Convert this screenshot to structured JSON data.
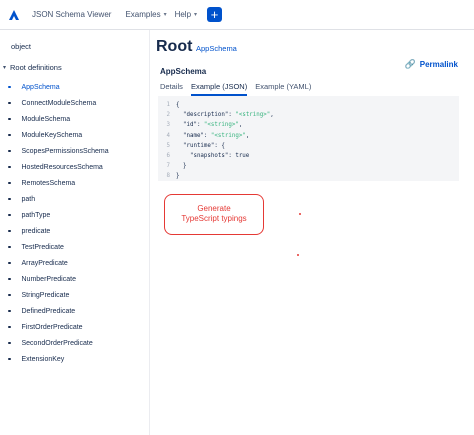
{
  "header": {
    "app_title": "JSON Schema Viewer",
    "nav": [
      {
        "label": "Examples"
      },
      {
        "label": "Help"
      }
    ],
    "plus_label": "+"
  },
  "sidebar": {
    "object_label": "object",
    "root_definitions_label": "Root definitions",
    "items": [
      {
        "label": "AppSchema",
        "active": true
      },
      {
        "label": "ConnectModuleSchema"
      },
      {
        "label": "ModuleSchema"
      },
      {
        "label": "ModuleKeySchema"
      },
      {
        "label": "ScopesPermissionsSchema"
      },
      {
        "label": "HostedResourcesSchema"
      },
      {
        "label": "RemotesSchema"
      },
      {
        "label": "path"
      },
      {
        "label": "pathType"
      },
      {
        "label": "predicate"
      },
      {
        "label": "TestPredicate"
      },
      {
        "label": "ArrayPredicate"
      },
      {
        "label": "NumberPredicate"
      },
      {
        "label": "StringPredicate"
      },
      {
        "label": "DefinedPredicate"
      },
      {
        "label": "FirstOrderPredicate"
      },
      {
        "label": "SecondOrderPredicate"
      },
      {
        "label": "ExtensionKey"
      }
    ]
  },
  "main": {
    "title": "Root",
    "title_link": "AppSchema",
    "schema_name": "AppSchema",
    "permalink_label": "Permalink",
    "tabs": [
      {
        "label": "Details",
        "active": false
      },
      {
        "label": "Example (JSON)",
        "active": true
      },
      {
        "label": "Example (YAML)",
        "active": false
      }
    ],
    "code_lines": [
      {
        "num": "1",
        "text": "{",
        "str": ""
      },
      {
        "num": "2",
        "text": "  \"description\": ",
        "str": "\"<string>\"",
        "tail": ","
      },
      {
        "num": "3",
        "text": "  \"id\": ",
        "str": "\"<string>\"",
        "tail": ","
      },
      {
        "num": "4",
        "text": "  \"name\": ",
        "str": "\"<string>\"",
        "tail": ","
      },
      {
        "num": "5",
        "text": "  \"runtime\": {",
        "str": ""
      },
      {
        "num": "6",
        "text": "    \"snapshots\": true",
        "str": ""
      },
      {
        "num": "7",
        "text": "  }",
        "str": ""
      },
      {
        "num": "8",
        "text": "}",
        "str": ""
      }
    ]
  },
  "annotation": {
    "line1": "Generate",
    "line2": "TypeScript typings"
  },
  "colors": {
    "accent": "#0052cc",
    "annotation": "#e53935",
    "code_string": "#36b37e"
  },
  "icons": {
    "logo": "atlassian-logo-icon",
    "permalink": "link-icon",
    "chevron": "chevron-down-icon"
  }
}
